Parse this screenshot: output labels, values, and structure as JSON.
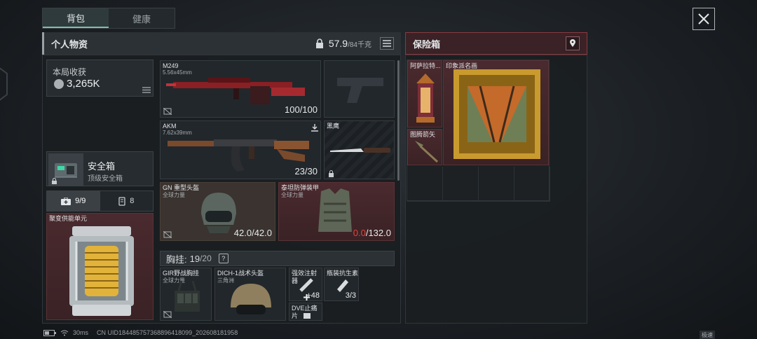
{
  "tabs": [
    {
      "label": "背包"
    },
    {
      "label": "健康"
    }
  ],
  "personal": {
    "title": "个人物资",
    "weight_current": "57.9",
    "weight_max": "/84千克"
  },
  "harvest": {
    "label": "本局收获",
    "value": "3,265K"
  },
  "safe_box": {
    "name": "安全箱",
    "grade": "顶级安全箱"
  },
  "subtabs": [
    {
      "label": "9/9",
      "icon": "medkit-icon"
    },
    {
      "label": "8",
      "icon": "magazine-icon"
    }
  ],
  "fusion": {
    "name": "聚变供能单元"
  },
  "primary": {
    "name": "M249",
    "ammo": "5.56x45mm",
    "value": "100/100"
  },
  "secondary": {
    "name": "AKM",
    "ammo": "7.62x39mm",
    "value": "23/30"
  },
  "melee": {
    "name": "黑鹰"
  },
  "helmet": {
    "name": "GN 重型头盔",
    "sub": "全球力量",
    "value": "42.0/42.0"
  },
  "armor": {
    "name": "泰坦防弹装甲",
    "sub": "全球力量",
    "value_current": "0.0",
    "value_max": "/132.0"
  },
  "rig": {
    "label": "胸挂: ",
    "current": "19",
    "max": "/20",
    "help": "?"
  },
  "rig_items": [
    {
      "name": "GIR野战胸挂",
      "sub": "全球力量"
    },
    {
      "name": "DICH-1战术头盔",
      "sub": "三角洲"
    },
    {
      "name": "强效注射器",
      "value": "+48"
    },
    {
      "name": "瓶装抗生素",
      "value": "3/3"
    },
    {
      "name": "DVE止痛片"
    }
  ],
  "safe": {
    "title": "保险箱",
    "items": [
      {
        "name": "阿萨拉特..."
      },
      {
        "name": "印象派名画"
      },
      {
        "name": "图腾箭矢"
      }
    ]
  },
  "footer": {
    "ping": "30ms",
    "uid": "CN UID184485757368896418099_202608181958"
  },
  "corner_tag": "极速",
  "colors": {
    "accent_red": "#d0393f",
    "value_red": "#e0443e"
  }
}
